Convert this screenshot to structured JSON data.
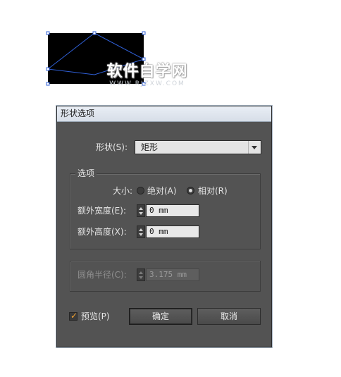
{
  "watermark": {
    "main": "软件自学网",
    "sub": "WWW.RJZXW.COM"
  },
  "dialog": {
    "title": "形状选项",
    "shape": {
      "label": "形状(S):",
      "value": "矩形"
    },
    "options": {
      "legend": "选项",
      "size_label": "大小:",
      "absolute_label": "绝对(A)",
      "relative_label": "相对(R)",
      "selected": "relative",
      "extra_width_label": "额外宽度(E):",
      "extra_width_value": "0 mm",
      "extra_height_label": "额外高度(X):",
      "extra_height_value": "0 mm"
    },
    "radius": {
      "label": "圆角半径(C):",
      "value": "3.175 mm"
    },
    "preview": {
      "label": "预览(P)",
      "checked": true
    },
    "ok_label": "确定",
    "cancel_label": "取消"
  },
  "colors": {
    "dialog_bg": "#535353",
    "canvas_shape": "#000000",
    "selection": "#2f5fd6",
    "check_accent": "#f0a030"
  },
  "icons": {
    "dropdown": "chevron-down-icon",
    "spinner": "spinner-arrows-icon",
    "check": "check-icon"
  }
}
